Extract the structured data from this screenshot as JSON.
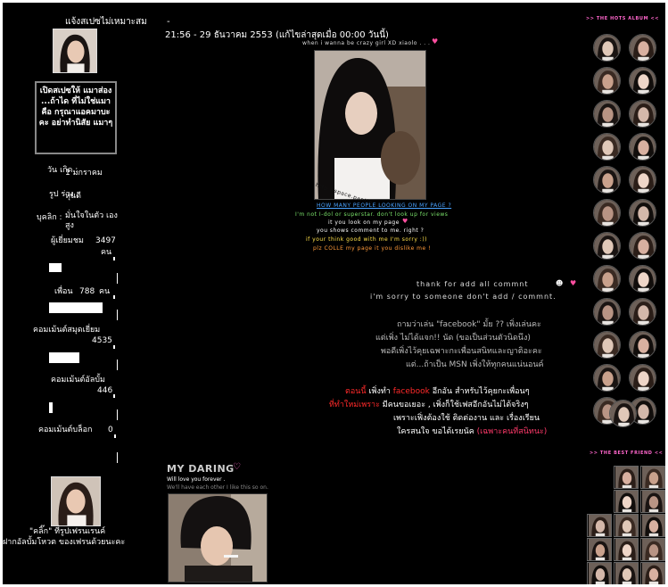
{
  "left": {
    "profile_title": "แจ้งสเปซไม่เหมาะสม",
    "notice": "เปิดสเปซให้ แมาส่อง ...ถ้าได ที่ไม่ใช่แมา คือ กรุณาแอคมาบะ คะ อย่าทำนิสัย แมาๆ",
    "birthday_label": "วัน เกิด :",
    "birthday_value": "1 มกราคม",
    "shape_label": "รูป ร่าง :",
    "shape_value": "หุ่นดี",
    "personality_label": "บุคลิก :",
    "personality_value": "มั่นใจในตัว เองสูง",
    "visitors_label": "ผู้เยี่ยมชม",
    "visitors_value": "3497",
    "visitors_unit": "คน",
    "friends_label": "เพื่อน",
    "friends_value": "788",
    "friends_unit": "คน",
    "guestbook_label": "คอมเม้นต์สมุดเยี่ยม",
    "guestbook_value": "4535",
    "album_label": "คอมเม้นต์อัลบั้ม",
    "album_value": "446",
    "blog_label": "คอมเม้นต์บล็อก",
    "blog_value": "0",
    "click_text": "\"คลิ๊ก\" ที่รูปเฟรนเรนค์",
    "vote_text": "ฝากอัลบั้มโหวต ของเฟรนด้วยนะคะ"
  },
  "center": {
    "dash": "-",
    "datetime": "21:56 - 29 ธันวาคม 2553 (แก้ไขล่าสุดเมื่อ 00:00 วันนี้)",
    "banner_caption": "when i wanna be crazy girl XD xiaolo . . .",
    "photo_watermark": "http://space.pantip.com/xiaolo",
    "msg_lines": [
      "HOW MANY PEOPLE LOOKING ON MY PAGE ?",
      "I'm not I-dol or superstar. don't look up for views",
      "it you look on my page",
      "you shows comment to me. right ?",
      "if your think good with me I'm sorry :))",
      "plz COLLE my page it you dislike me !"
    ],
    "thanks_line": "thank for add all commnt",
    "sorry_line": "i'm sorry to someone don't add / commnt.",
    "fb_ask_1": "ถามว่าเล่น \"facebook\" มั้ย ?? เพิ่งเล่นคะ",
    "fb_ask_2": "แต่เพิ่ง ไม่ได้แจก!! นัด (ขอเป็นส่วนตัวนิดนึง)",
    "fb_ask_3": "พอดีเพิ่งไว้คุยเฉพาะกะเพื่อนสนิทและญาติอะคะ",
    "fb_ask_4": "แต่...ถ้าเป็น MSN เพิ่งให้ทุกคนแน่นอนค์",
    "note_red_1": "ตอนนี้",
    "note_white_1": "เพิ่งทำ",
    "note_red_fb": "facebook",
    "note_white_2": "อีกอัน สำหรับไว้คุยกะเพื่อนๆ",
    "note_red_2": "ที่ทำใหม่เพราะ",
    "note_white_3": "มีคนขอเยอะ , เพิ่งก็ใช้เฟสอีกอันไม่ได้จริงๆ",
    "note_white_4": "เพราะเฟิ่งต้องใช้ ติดต่องาน และ เรื่องเรียน",
    "note_white_5": "ใครสนใจ ขอได้เรยนัค",
    "note_red_3": "(เฉพาะคนที่สนิทนะ)",
    "daring_title": "MY DARING",
    "daring_line1": "Will love you forever .",
    "daring_line2": "We'll have each other I like this so on."
  },
  "right": {
    "album_header": ">> THE HOTS ALBUM <<",
    "friends_header": ">> THE BEST FRIEND <<"
  },
  "colors": {
    "background": "#000000",
    "accent_red": "#ff2a2a",
    "accent_pink": "#ff4fa0",
    "text_gray": "#bbbbbb",
    "header_cyan": "#00e5ff",
    "header_pink": "#ff66cc"
  }
}
